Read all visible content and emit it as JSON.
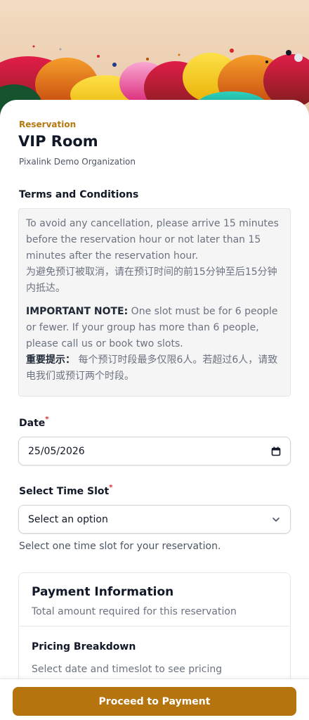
{
  "header": {
    "eyebrow": "Reservation",
    "title": "VIP Room",
    "organization": "Pixalink Demo Organization"
  },
  "terms": {
    "heading": "Terms and Conditions",
    "paragraph1_en": "To avoid any cancellation, please arrive 15 minutes before the reservation hour or not later than 15 minutes after the reservation hour.",
    "paragraph1_zh": "为避免预订被取消，请在预订时间的前15分钟至后15分钟内抵达。",
    "note_label_en": "IMPORTANT NOTE:",
    "note_text_en": " One slot must be for 6 people or fewer. If your group has more than 6 people, please call us or book two slots.",
    "note_label_zh": "重要提示：",
    "note_text_zh": " 每个预订时段最多仅限6人。若超过6人，请致电我们或预订两个时段。"
  },
  "date_field": {
    "label": "Date",
    "required_mark": "*",
    "value": "25/05/2026",
    "icon": "calendar-icon"
  },
  "timeslot_field": {
    "label": "Select Time Slot",
    "required_mark": "*",
    "selected": "Select an option",
    "icon": "chevron-down-icon",
    "helper": "Select one time slot for your reservation."
  },
  "payment": {
    "title": "Payment Information",
    "subtitle": "Total amount required for this reservation",
    "breakdown_heading": "Pricing Breakdown",
    "breakdown_note": "Select date and timeslot to see pricing"
  },
  "footer": {
    "proceed_label": "Proceed to Payment"
  },
  "colors": {
    "accent": "#b5740e",
    "eyebrow": "#b7770e",
    "required": "#dc2626"
  }
}
